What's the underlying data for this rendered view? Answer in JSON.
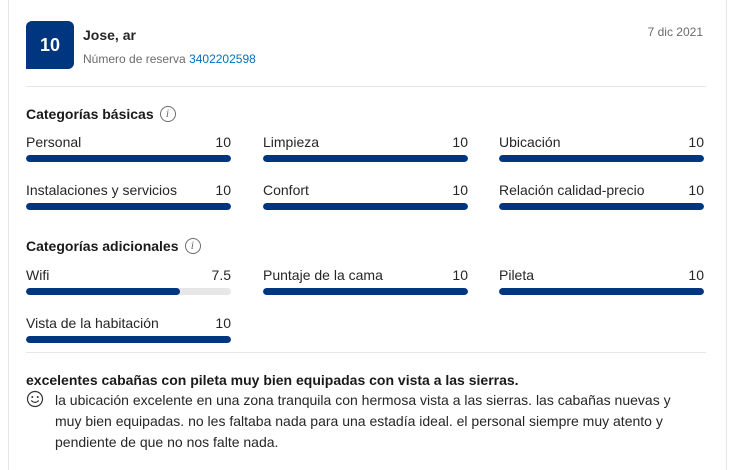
{
  "review": {
    "score": "10",
    "reviewer_name": "Jose, ar",
    "reservation_label": "Número de reserva",
    "reservation_number": "3402202598",
    "date": "7 dic 2021",
    "title": "excelentes cabañas con pileta muy bien equipadas con vista a las sierras.",
    "body": "la ubicación excelente en una zona tranquila con hermosa vista a las sierras. las cabañas nuevas y muy bien equipadas. no les faltaba nada para una estadía ideal. el personal siempre muy atento y pendiente de que no nos falte nada.",
    "positive_icon": "smile-icon"
  },
  "basic": {
    "title": "Categorías básicas",
    "info_icon": "info-icon",
    "items": [
      {
        "label": "Personal",
        "score": "10",
        "fraction": 1.0
      },
      {
        "label": "Limpieza",
        "score": "10",
        "fraction": 1.0
      },
      {
        "label": "Ubicación",
        "score": "10",
        "fraction": 1.0
      },
      {
        "label": "Instalaciones y servicios",
        "score": "10",
        "fraction": 1.0
      },
      {
        "label": "Confort",
        "score": "10",
        "fraction": 1.0
      },
      {
        "label": "Relación calidad-precio",
        "score": "10",
        "fraction": 1.0
      }
    ]
  },
  "additional": {
    "title": "Categorías adicionales",
    "info_icon": "info-icon",
    "items": [
      {
        "label": "Wifi",
        "score": "7.5",
        "fraction": 0.75
      },
      {
        "label": "Puntaje de la cama",
        "score": "10",
        "fraction": 1.0
      },
      {
        "label": "Pileta",
        "score": "10",
        "fraction": 1.0
      },
      {
        "label": "Vista de la habitación",
        "score": "10",
        "fraction": 1.0
      }
    ]
  },
  "colors": {
    "brand": "#003580",
    "link": "#0071c2",
    "track": "#e7e7e7"
  }
}
